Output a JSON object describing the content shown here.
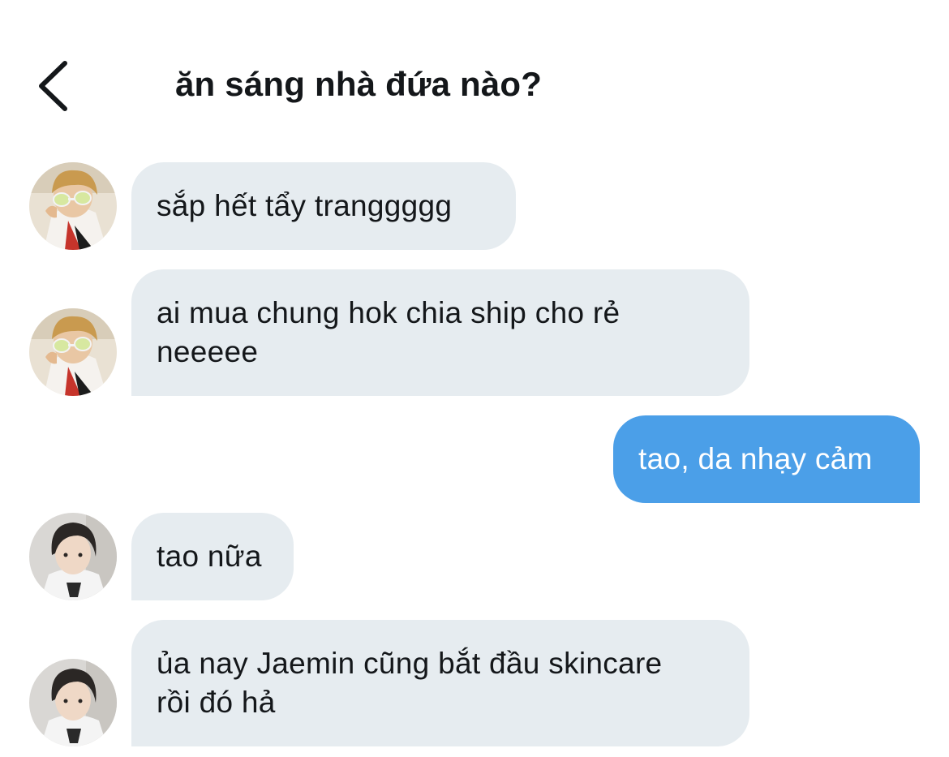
{
  "header": {
    "title": "ăn sáng nhà đứa nào?",
    "back_icon": "chevron-left-icon"
  },
  "colors": {
    "incoming_bubble": "#e6ecf0",
    "outgoing_bubble": "#4b9fe8",
    "text": "#14171a"
  },
  "messages": [
    {
      "direction": "incoming",
      "avatar": "user-a",
      "lines": [
        "sắp hết tẩy tranggggg"
      ]
    },
    {
      "direction": "incoming",
      "avatar": "user-a",
      "lines": [
        "ai mua chung hok chia ship cho rẻ",
        "neeeee"
      ]
    },
    {
      "direction": "outgoing",
      "lines": [
        "tao, da nhạy cảm"
      ]
    },
    {
      "direction": "incoming",
      "avatar": "user-b",
      "lines": [
        "tao nữa"
      ]
    },
    {
      "direction": "incoming",
      "avatar": "user-b",
      "lines": [
        "ủa nay Jaemin cũng bắt đầu skincare",
        "rồi đó hả"
      ]
    }
  ]
}
